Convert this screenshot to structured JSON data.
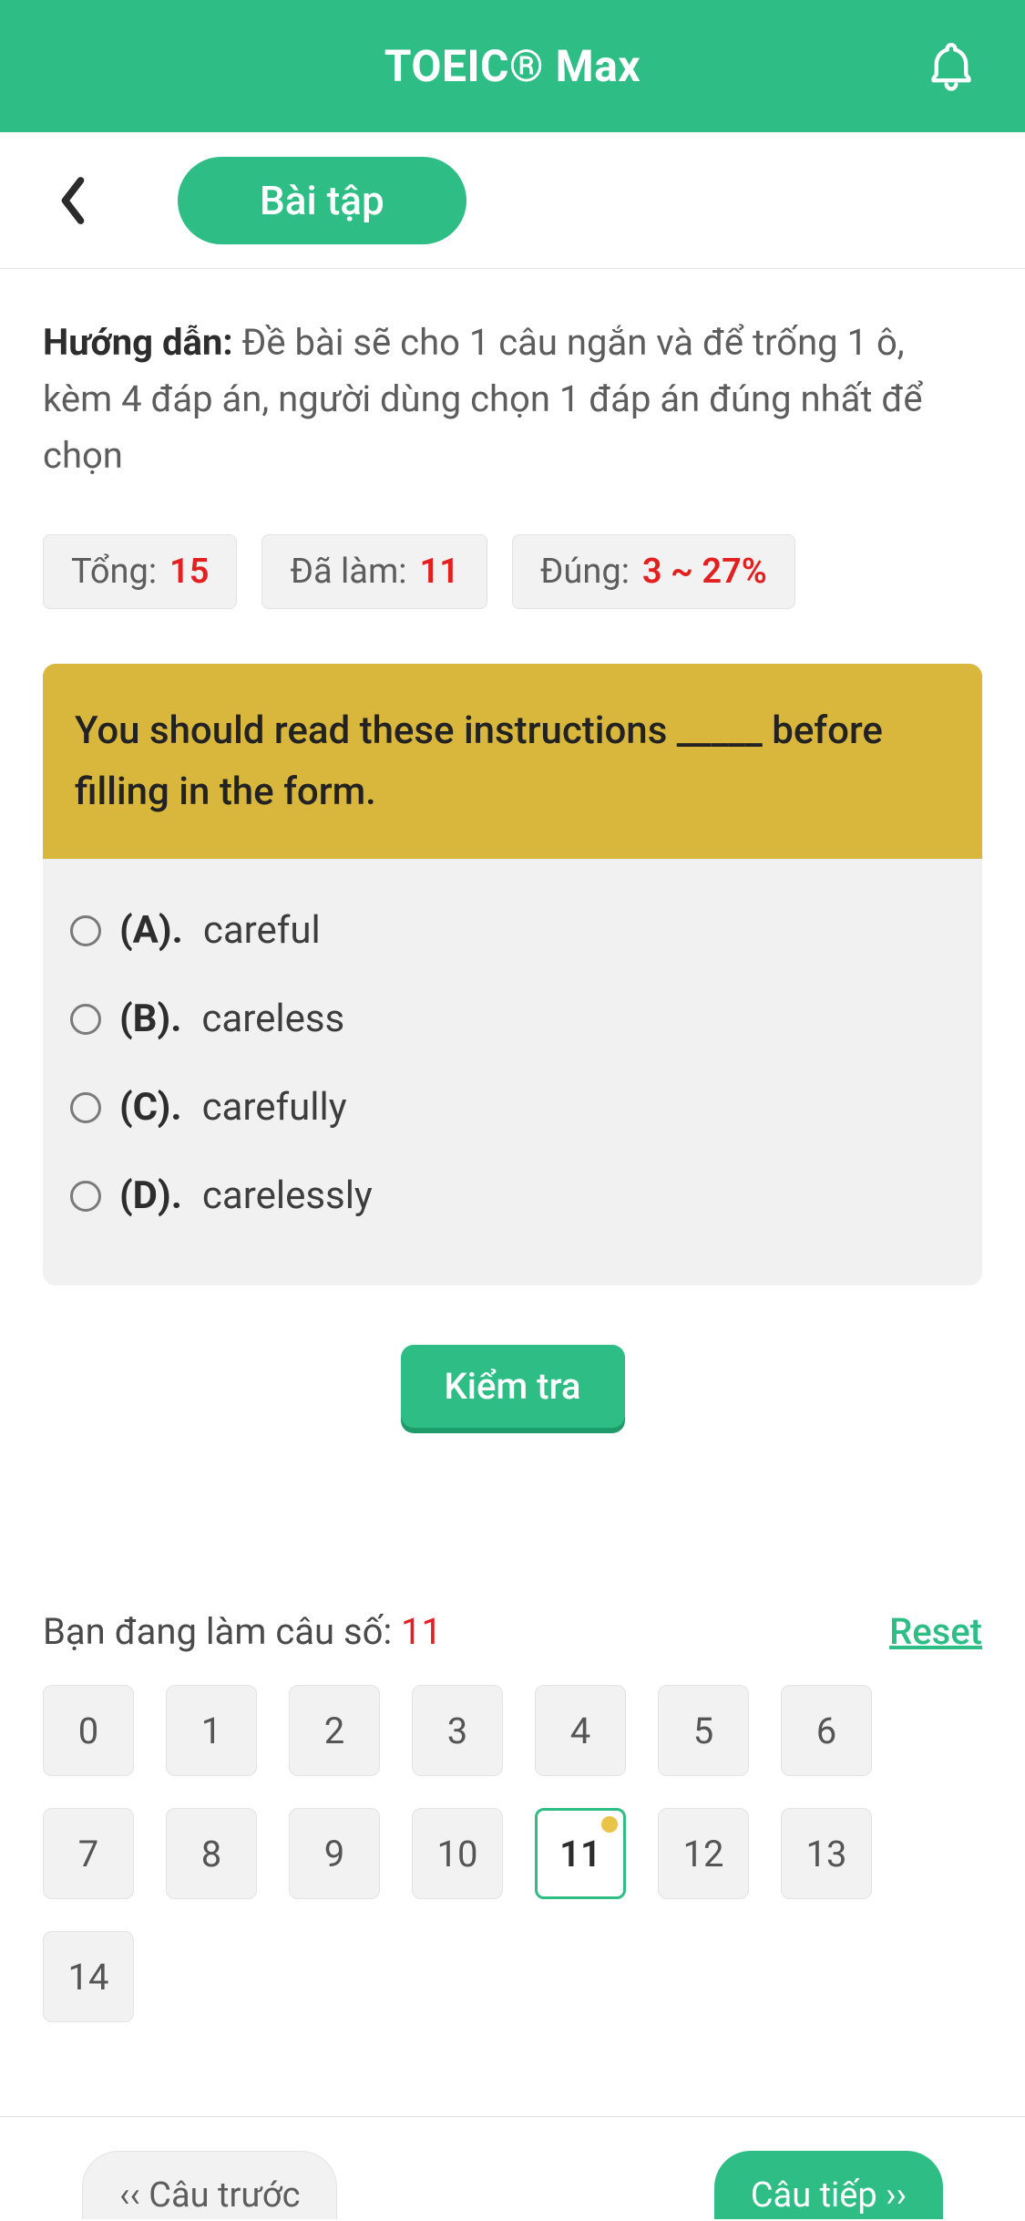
{
  "header": {
    "title": "TOEIC® Max"
  },
  "subheader": {
    "pill_label": "Bài tập"
  },
  "instructions": {
    "label": "Hướng dẫn:",
    "text": "Đề bài sẽ cho 1 câu ngắn và để trống 1 ô, kèm 4 đáp án, người dùng chọn 1 đáp án đúng nhất để chọn"
  },
  "stats": {
    "total_label": "Tổng:",
    "total_value": "15",
    "done_label": "Đã làm:",
    "done_value": "11",
    "correct_label": "Đúng:",
    "correct_value": "3 ~ 27%"
  },
  "question": {
    "prompt": "You should read these instructions _____ before filling in the form.",
    "options": [
      {
        "letter": "(A).",
        "text": "careful"
      },
      {
        "letter": "(B).",
        "text": "careless"
      },
      {
        "letter": "(C).",
        "text": "carefully"
      },
      {
        "letter": "(D).",
        "text": "carelessly"
      }
    ]
  },
  "check_label": "Kiểm tra",
  "progress": {
    "label": "Bạn đang làm câu số:",
    "current": "11",
    "reset_label": "Reset",
    "numbers": [
      "0",
      "1",
      "2",
      "3",
      "4",
      "5",
      "6",
      "7",
      "8",
      "9",
      "10",
      "11",
      "12",
      "13",
      "14"
    ],
    "current_index": 11
  },
  "nav": {
    "prev": "‹‹ Câu trước",
    "next": "Câu tiếp ››"
  }
}
